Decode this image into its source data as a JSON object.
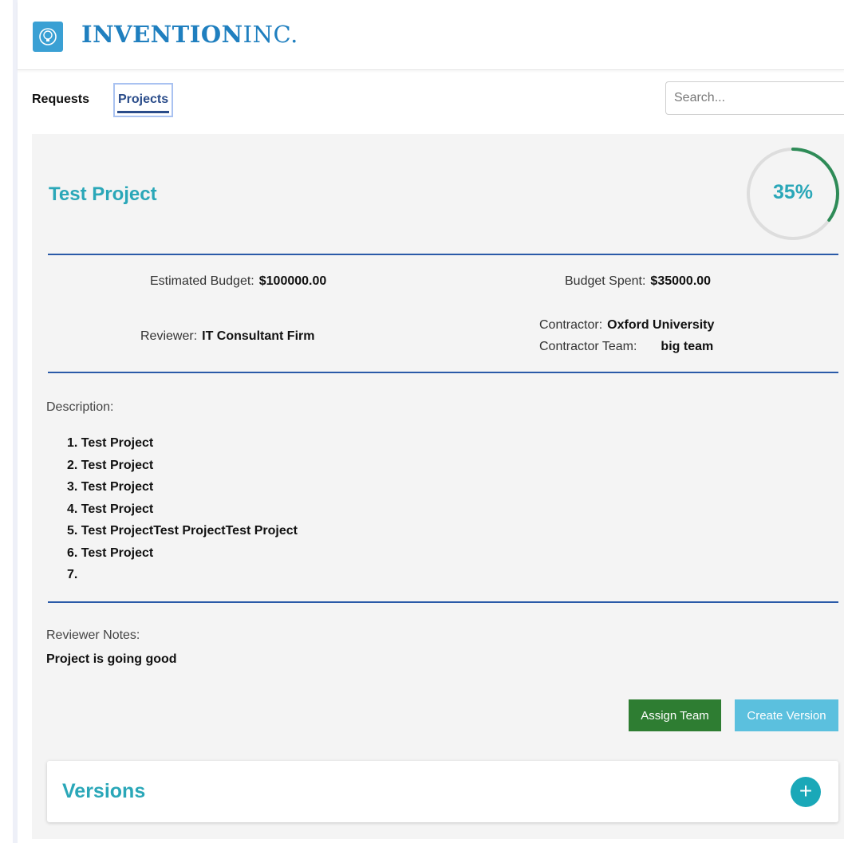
{
  "header": {
    "brand_bold": "INVENTION",
    "brand_light": "INC.",
    "logo_icon": "lightbulb-brain-icon",
    "brand_color": "#1f7fbf"
  },
  "nav": {
    "tabs": [
      {
        "label": "Requests",
        "active": false
      },
      {
        "label": "Projects",
        "active": true
      }
    ],
    "search_placeholder": "Search..."
  },
  "project": {
    "title": "Test Project",
    "progress_value": 35,
    "progress_text": "35%",
    "progress_color": "#2e8b57",
    "estimated_budget_label": "Estimated Budget:",
    "estimated_budget_value": "$100000.00",
    "budget_spent_label": "Budget Spent:",
    "budget_spent_value": "$35000.00",
    "reviewer_label": "Reviewer:",
    "reviewer_value": "IT Consultant Firm",
    "contractor_label": "Contractor:",
    "contractor_value": "Oxford University",
    "contractor_team_label": "Contractor Team:",
    "contractor_team_value": "big team",
    "description_label": "Description:",
    "description_items": [
      "1. Test Project",
      "2. Test Project",
      "3. Test Project",
      "4. Test Project",
      "5. Test ProjectTest ProjectTest Project",
      "6. Test Project",
      "7."
    ],
    "reviewer_notes_label": "Reviewer Notes:",
    "reviewer_notes_value": "Project is going good"
  },
  "actions": {
    "assign_team": "Assign Team",
    "create_version": "Create Version"
  },
  "versions": {
    "title": "Versions",
    "add_icon": "plus-icon",
    "add_symbol": "+"
  }
}
